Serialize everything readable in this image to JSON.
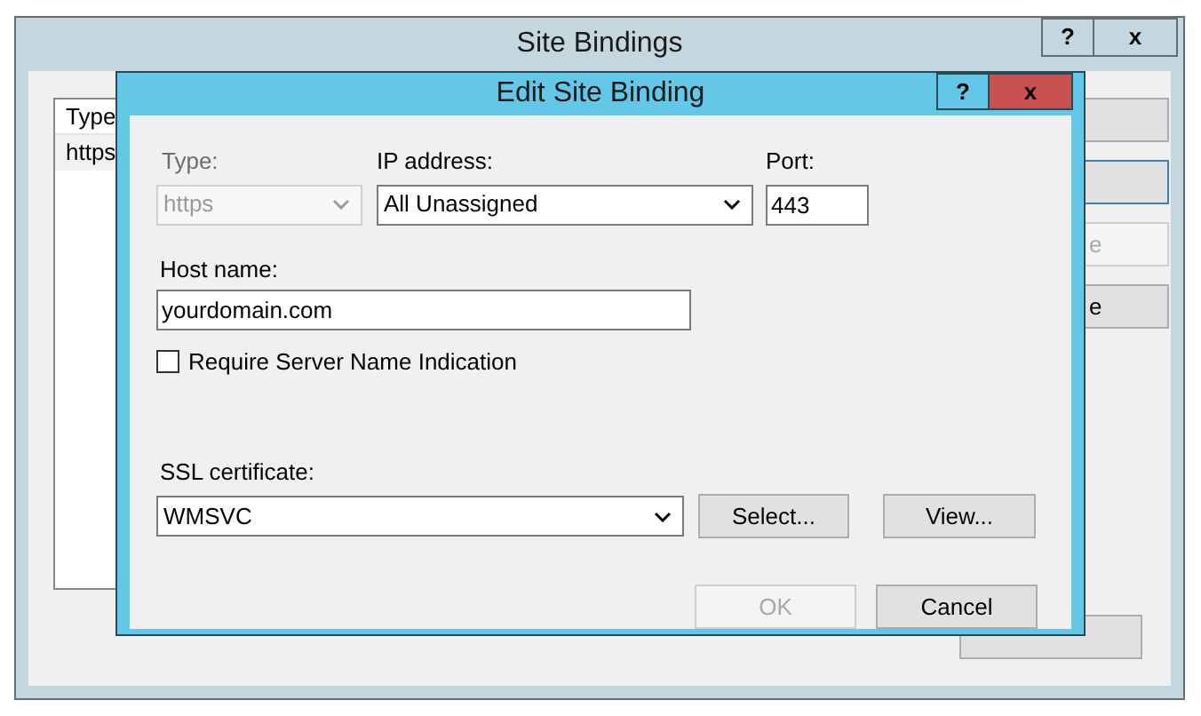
{
  "back_window": {
    "title": "Site Bindings",
    "help": "?",
    "close": "x",
    "list": {
      "columns": [
        "Type"
      ],
      "rows": [
        {
          "cells": [
            "https"
          ],
          "selected": true
        }
      ]
    },
    "side_buttons": [
      {
        "disabled": false,
        "focused": false
      },
      {
        "disabled": false,
        "focused": true
      },
      {
        "label": "e",
        "disabled": true,
        "focused": false
      },
      {
        "label": "e",
        "disabled": false,
        "focused": false
      }
    ],
    "bottom_button": {
      "disabled": false
    }
  },
  "dialog": {
    "title": "Edit Site Binding",
    "help": "?",
    "close": "x",
    "type": {
      "label": "Type:",
      "value": "https",
      "disabled": true
    },
    "ip": {
      "label": "IP address:",
      "value": "All Unassigned",
      "disabled": false
    },
    "port": {
      "label": "Port:",
      "value": "443"
    },
    "host": {
      "label": "Host name:",
      "value": "yourdomain.com"
    },
    "sni": {
      "label": "Require Server Name Indication",
      "checked": false
    },
    "ssl": {
      "label": "SSL certificate:",
      "value": "WMSVC",
      "disabled": false
    },
    "cert_buttons": [
      {
        "label": "Select...",
        "disabled": false
      },
      {
        "label": "View...",
        "disabled": false
      }
    ],
    "buttons": [
      {
        "label": "OK",
        "disabled": true
      },
      {
        "label": "Cancel",
        "disabled": false
      }
    ]
  }
}
